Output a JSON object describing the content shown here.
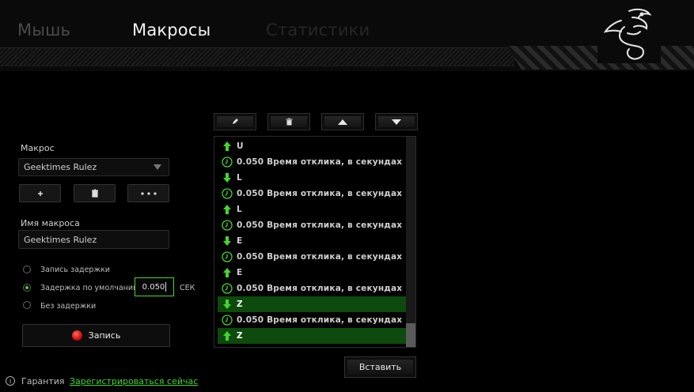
{
  "header": {
    "tabs": [
      {
        "label": "Мышь",
        "active": false
      },
      {
        "label": "Макросы",
        "active": true
      },
      {
        "label": "Статистики",
        "active": false
      }
    ],
    "logo_icon": "razer-snake-logo"
  },
  "macro_panel": {
    "macro_label": "Макрос",
    "macro_selected": "Geektimes Rulez",
    "add_icon": "plus-icon",
    "delete_icon": "trash-icon",
    "more_icon": "ellipsis-icon",
    "name_label": "Имя макроса",
    "name_value": "Geektimes Rulez",
    "delay_options": [
      {
        "label": "Запись задержки",
        "selected": false
      },
      {
        "label": "Задержка по умолчанию",
        "selected": true
      },
      {
        "label": "Без задержки",
        "selected": false
      }
    ],
    "delay_value": "0.050",
    "delay_unit": "СЕК",
    "record_label": "Запись"
  },
  "toolbar": {
    "icons": [
      "pencil-icon",
      "trash-icon",
      "move-up-icon",
      "move-down-icon"
    ]
  },
  "macro_list": {
    "rows": [
      {
        "type": "up",
        "text": "U",
        "selected": false
      },
      {
        "type": "delay",
        "text": "0.050 Время отклика, в секундах",
        "selected": false
      },
      {
        "type": "down",
        "text": "L",
        "selected": false
      },
      {
        "type": "delay",
        "text": "0.050 Время отклика, в секундах",
        "selected": false
      },
      {
        "type": "up",
        "text": "L",
        "selected": false
      },
      {
        "type": "delay",
        "text": "0.050 Время отклика, в секундах",
        "selected": false
      },
      {
        "type": "down",
        "text": "E",
        "selected": false
      },
      {
        "type": "delay",
        "text": "0.050 Время отклика, в секундах",
        "selected": false
      },
      {
        "type": "up",
        "text": "E",
        "selected": false
      },
      {
        "type": "delay",
        "text": "0.050 Время отклика, в секундах",
        "selected": false
      },
      {
        "type": "down",
        "text": "Z",
        "selected": true
      },
      {
        "type": "delay",
        "text": "0.050 Время отклика, в секундах",
        "selected": false
      },
      {
        "type": "up",
        "text": "Z",
        "selected": true
      }
    ],
    "insert_label": "Вставить"
  },
  "footer": {
    "warranty_label": "Гарантия",
    "register_link": "Зарегистрироваться сейчас"
  },
  "colors": {
    "accent": "#44d62c",
    "selected_row": "#0d4a0d",
    "record": "#e00000"
  }
}
